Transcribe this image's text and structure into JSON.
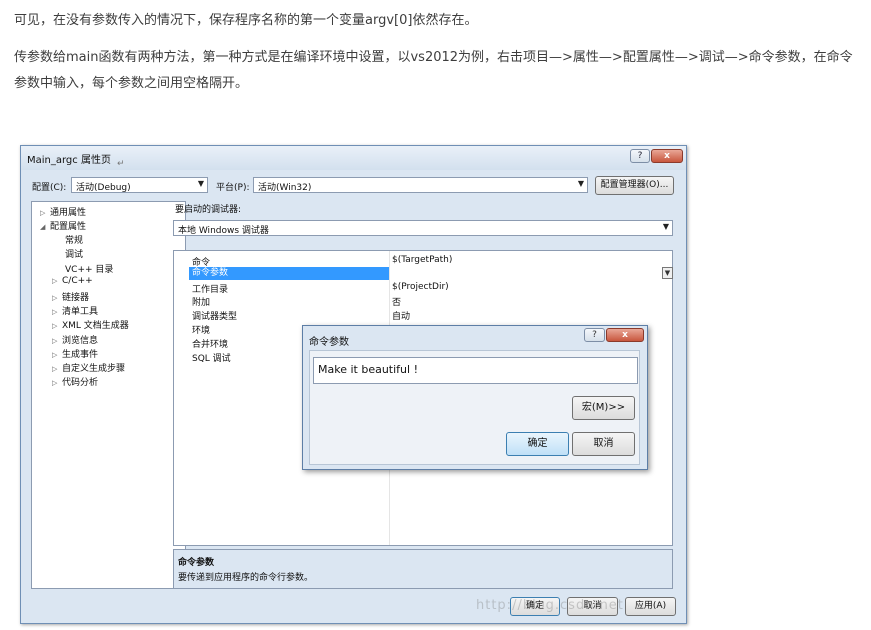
{
  "article": {
    "p1": "可见，在没有参数传入的情况下，保存程序名称的第一个变量argv[0]依然存在。",
    "p2": "传参数给main函数有两种方法，第一种方式是在编译环境中设置，以vs2012为例，右击项目—>属性—>配置属性—>调试—>命令参数，在命令参数中输入，每个参数之间用空格隔开。"
  },
  "window": {
    "title": "Main_argc 属性页",
    "cursor_glyph": "↵",
    "help": "?",
    "close": "x",
    "config_label": "配置(C):",
    "config_value": "活动(Debug)",
    "platform_label": "平台(P):",
    "platform_value": "活动(Win32)",
    "config_manager": "配置管理器(O)...",
    "tree": [
      {
        "label": "通用属性",
        "twisty": "▷"
      },
      {
        "label": "配置属性",
        "twisty": "◢"
      },
      {
        "label": "常规",
        "twisty": ""
      },
      {
        "label": "调试",
        "twisty": ""
      },
      {
        "label": "VC++ 目录",
        "twisty": ""
      },
      {
        "label": "C/C++",
        "twisty": "▷"
      },
      {
        "label": "链接器",
        "twisty": "▷"
      },
      {
        "label": "清单工具",
        "twisty": "▷"
      },
      {
        "label": "XML 文档生成器",
        "twisty": "▷"
      },
      {
        "label": "浏览信息",
        "twisty": "▷"
      },
      {
        "label": "生成事件",
        "twisty": "▷"
      },
      {
        "label": "自定义生成步骤",
        "twisty": "▷"
      },
      {
        "label": "代码分析",
        "twisty": "▷"
      }
    ],
    "debugger_label": "要启动的调试器:",
    "debugger_value": "本地 Windows 调试器",
    "props": [
      {
        "key": "命令",
        "value": "$(TargetPath)"
      },
      {
        "key": "命令参数",
        "value": ""
      },
      {
        "key": "工作目录",
        "value": "$(ProjectDir)"
      },
      {
        "key": "附加",
        "value": "否"
      },
      {
        "key": "调试器类型",
        "value": "自动"
      },
      {
        "key": "环境",
        "value": ""
      },
      {
        "key": "合并环境",
        "value": ""
      },
      {
        "key": "SQL 调试",
        "value": ""
      }
    ],
    "desc_title": "命令参数",
    "desc_text": "要传递到应用程序的命令行参数。",
    "ok": "确定",
    "cancel": "取消",
    "apply": "应用(A)"
  },
  "dialog": {
    "title": "命令参数",
    "help": "?",
    "close": "x",
    "value": "Make it beautiful !",
    "macro": "宏(M)>>",
    "ok": "确定",
    "cancel": "取消"
  },
  "watermark": "http://blog.csdn.net"
}
